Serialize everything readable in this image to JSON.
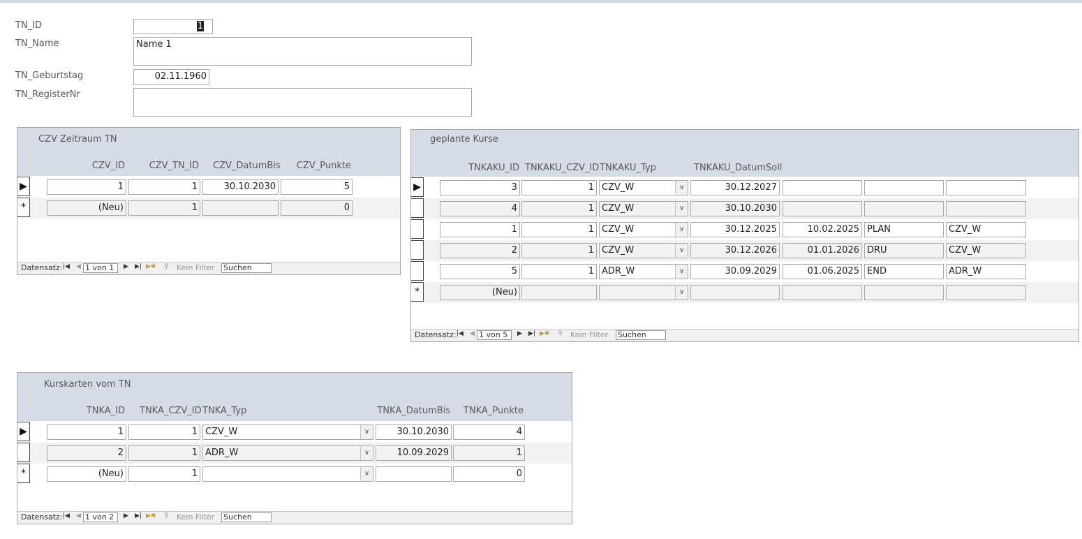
{
  "main_form": {
    "tn_id_label": "TN_ID",
    "tn_id_value": "1",
    "tn_name_label": "TN_Name",
    "tn_name_value": "Name 1",
    "tn_geburtstag_label": "TN_Geburtstag",
    "tn_geburtstag_value": "02.11.1960",
    "tn_registernr_label": "TN_RegisterNr",
    "tn_registernr_value": ""
  },
  "czv": {
    "title": "CZV Zeitraum TN",
    "headers": [
      "CZV_ID",
      "CZV_TN_ID",
      "CZV_DatumBis",
      "CZV_Punkte"
    ],
    "rows": [
      {
        "selector": "▶",
        "cells": [
          "1",
          "1",
          "30.10.2030",
          "5"
        ]
      },
      {
        "selector": "*",
        "cells": [
          "(Neu)",
          "1",
          "",
          "0"
        ]
      }
    ],
    "nav": {
      "label": "Datensatz:",
      "position": "1 von 1",
      "filter": "Kein Filter",
      "search": "Suchen"
    }
  },
  "kurse": {
    "title": "geplante Kurse",
    "headers": [
      "TNKAKU_ID",
      "TNKAKU_CZV_ID",
      "TNKAKU_Typ",
      "TNKAKU_DatumSoll"
    ],
    "rows": [
      {
        "selector": "▶",
        "cells": [
          "3",
          "1",
          "CZV_W",
          "30.12.2027",
          "",
          "",
          ""
        ]
      },
      {
        "selector": "",
        "cells": [
          "4",
          "1",
          "CZV_W",
          "30.10.2030",
          "",
          "",
          ""
        ]
      },
      {
        "selector": "",
        "cells": [
          "1",
          "1",
          "CZV_W",
          "30.12.2025",
          "10.02.2025",
          "PLAN",
          "CZV_W"
        ]
      },
      {
        "selector": "",
        "cells": [
          "2",
          "1",
          "CZV_W",
          "30.12.2026",
          "01.01.2026",
          "DRU",
          "CZV_W"
        ]
      },
      {
        "selector": "",
        "cells": [
          "5",
          "1",
          "ADR_W",
          "30.09.2029",
          "01.06.2025",
          "END",
          "ADR_W"
        ]
      },
      {
        "selector": "*",
        "cells": [
          "(Neu)",
          "",
          "",
          "",
          "",
          "",
          ""
        ]
      }
    ],
    "nav": {
      "label": "Datensatz:",
      "position": "1 von 5",
      "filter": "Kein Filter",
      "search": "Suchen"
    }
  },
  "karten": {
    "title": "Kurskarten vom TN",
    "headers": [
      "TNKA_ID",
      "TNKA_CZV_ID",
      "TNKA_Typ",
      "TNKA_DatumBis",
      "TNKA_Punkte"
    ],
    "rows": [
      {
        "selector": "▶",
        "cells": [
          "1",
          "1",
          "CZV_W",
          "30.10.2030",
          "4"
        ]
      },
      {
        "selector": "",
        "cells": [
          "2",
          "1",
          "ADR_W",
          "10.09.2029",
          "1"
        ]
      },
      {
        "selector": "*",
        "cells": [
          "(Neu)",
          "1",
          "",
          "",
          "0"
        ]
      }
    ],
    "nav": {
      "label": "Datensatz:",
      "position": "1 von 2",
      "filter": "Kein Filter",
      "search": "Suchen"
    }
  }
}
